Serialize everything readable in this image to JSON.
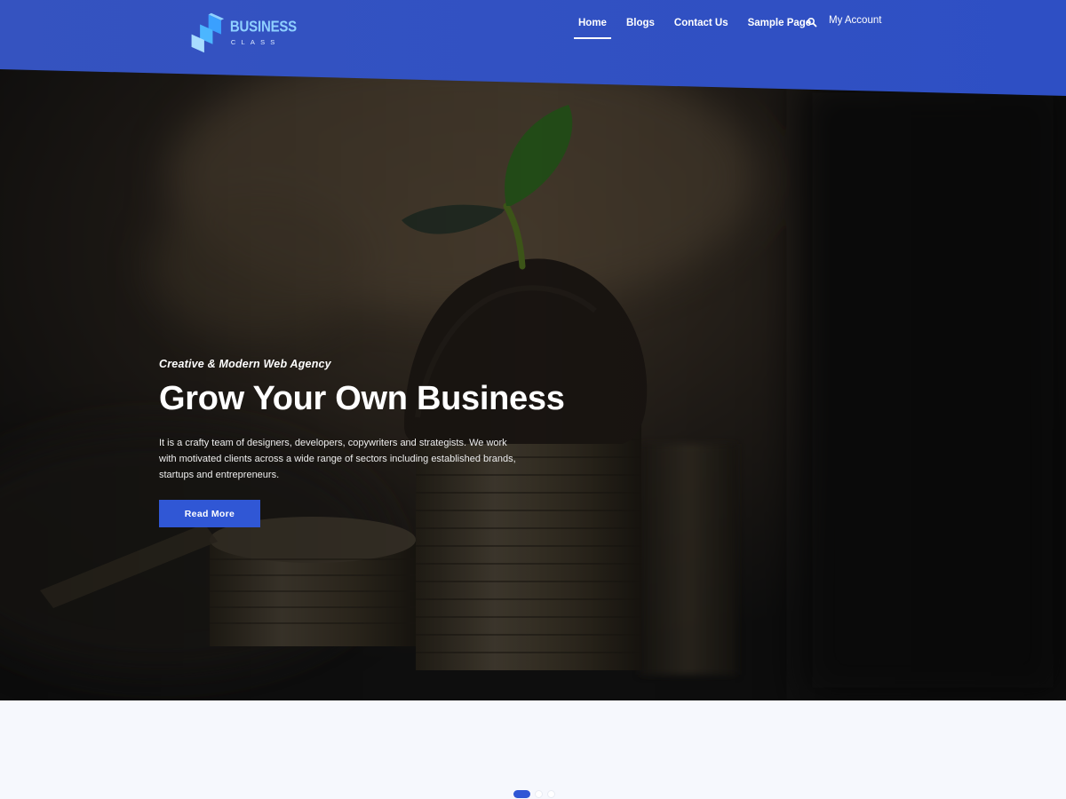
{
  "brand": {
    "name": "BUSINESS",
    "sub": "CLASS"
  },
  "nav": {
    "items": [
      {
        "label": "Home",
        "active": true
      },
      {
        "label": "Blogs",
        "active": false
      },
      {
        "label": "Contact Us",
        "active": false
      },
      {
        "label": "Sample Page",
        "active": false
      }
    ],
    "search_icon": "search-icon",
    "account_label": "My Account"
  },
  "hero": {
    "tagline": "Creative & Modern Web Agency",
    "title": "Grow Your Own Business",
    "description": "It is a crafty team of designers, developers, copywriters and strategists. We work with motivated clients across a wide range of sectors including established brands, startups and entrepreneurs.",
    "cta_label": "Read More"
  },
  "slider": {
    "count": 3,
    "active_index": 0
  },
  "colors": {
    "header_blue": "#3152c6",
    "accent": "#3057d5",
    "logo_light": "#8fd0ff",
    "page_bg": "#f6f8fd"
  }
}
